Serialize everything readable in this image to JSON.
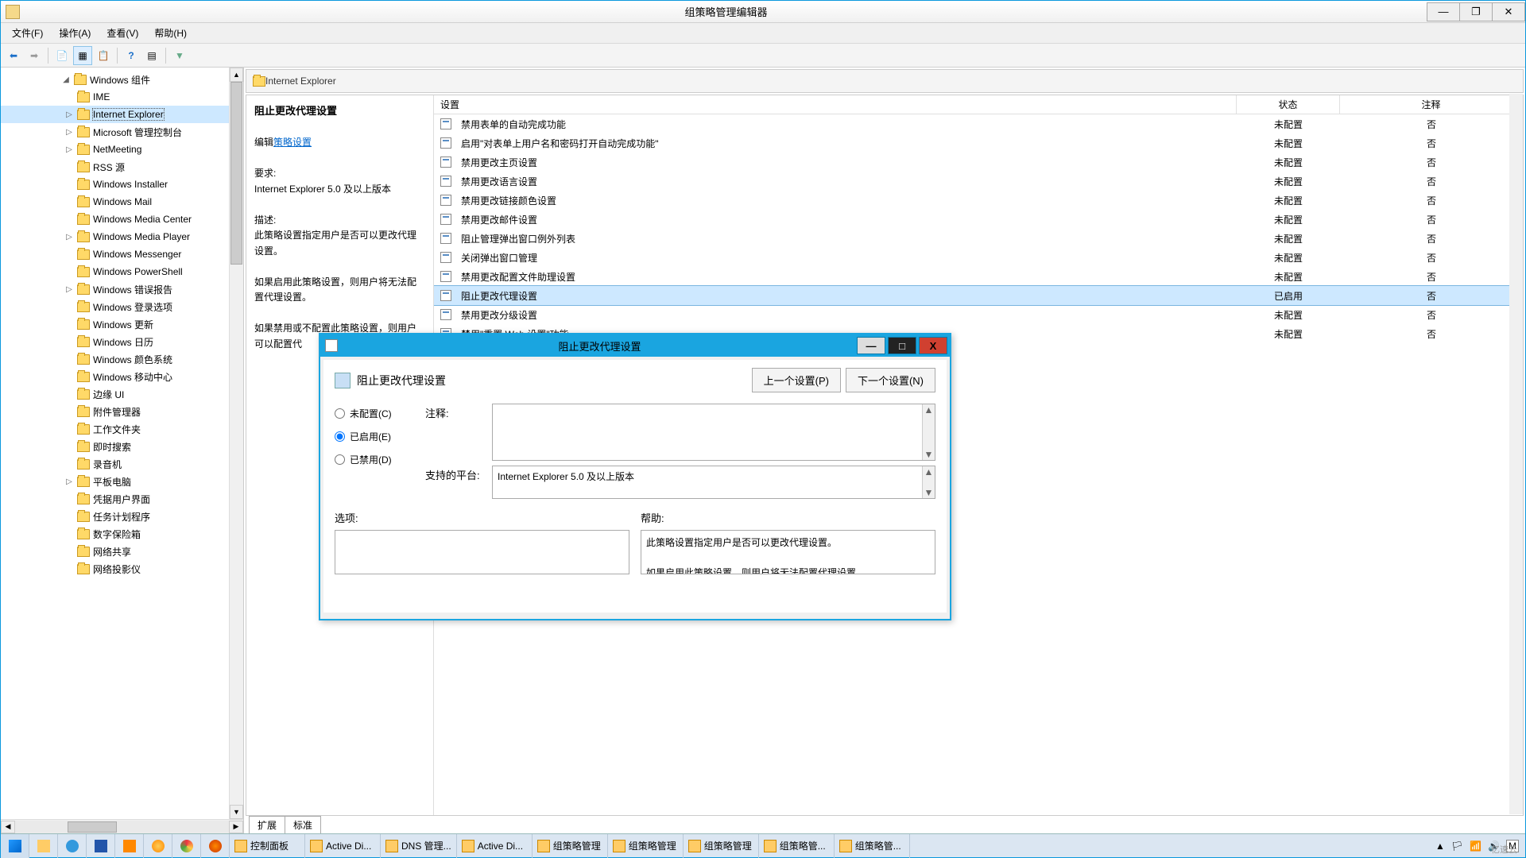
{
  "window": {
    "title": "组策略管理编辑器",
    "menu": {
      "file": "文件(F)",
      "action": "操作(A)",
      "view": "查看(V)",
      "help": "帮助(H)"
    }
  },
  "tree": {
    "root": "Windows 组件",
    "items": [
      {
        "label": "IME",
        "exp": ""
      },
      {
        "label": "Internet Explorer",
        "exp": "▷",
        "selected": true
      },
      {
        "label": "Microsoft 管理控制台",
        "exp": "▷"
      },
      {
        "label": "NetMeeting",
        "exp": "▷"
      },
      {
        "label": "RSS 源",
        "exp": ""
      },
      {
        "label": "Windows Installer",
        "exp": ""
      },
      {
        "label": "Windows Mail",
        "exp": ""
      },
      {
        "label": "Windows Media Center",
        "exp": ""
      },
      {
        "label": "Windows Media Player",
        "exp": "▷"
      },
      {
        "label": "Windows Messenger",
        "exp": ""
      },
      {
        "label": "Windows PowerShell",
        "exp": ""
      },
      {
        "label": "Windows 错误报告",
        "exp": "▷"
      },
      {
        "label": "Windows 登录选项",
        "exp": ""
      },
      {
        "label": "Windows 更新",
        "exp": ""
      },
      {
        "label": "Windows 日历",
        "exp": ""
      },
      {
        "label": "Windows 颜色系统",
        "exp": ""
      },
      {
        "label": "Windows 移动中心",
        "exp": ""
      },
      {
        "label": "边缘 UI",
        "exp": ""
      },
      {
        "label": "附件管理器",
        "exp": ""
      },
      {
        "label": "工作文件夹",
        "exp": ""
      },
      {
        "label": "即时搜索",
        "exp": ""
      },
      {
        "label": "录音机",
        "exp": ""
      },
      {
        "label": "平板电脑",
        "exp": "▷"
      },
      {
        "label": "凭据用户界面",
        "exp": ""
      },
      {
        "label": "任务计划程序",
        "exp": ""
      },
      {
        "label": "数字保险箱",
        "exp": ""
      },
      {
        "label": "网络共享",
        "exp": ""
      },
      {
        "label": "网络投影仪",
        "exp": ""
      }
    ]
  },
  "content": {
    "heading": "Internet Explorer",
    "setting_title": "阻止更改代理设置",
    "edit_prefix": "编辑",
    "edit_link": "策略设置",
    "req_label": "要求:",
    "req_text": "Internet Explorer 5.0 及以上版本",
    "desc_label": "描述:",
    "desc_text": "此策略设置指定用户是否可以更改代理设置。",
    "desc_p2": "如果启用此策略设置，则用户将无法配置代理设置。",
    "desc_p3": "如果禁用或不配置此策略设置，则用户可以配置代",
    "columns": {
      "setting": "设置",
      "state": "状态",
      "note": "注释"
    },
    "rows": [
      {
        "s": "禁用表单的自动完成功能",
        "st": "未配置",
        "n": "否"
      },
      {
        "s": "启用\"对表单上用户名和密码打开自动完成功能\"",
        "st": "未配置",
        "n": "否"
      },
      {
        "s": "禁用更改主页设置",
        "st": "未配置",
        "n": "否"
      },
      {
        "s": "禁用更改语言设置",
        "st": "未配置",
        "n": "否"
      },
      {
        "s": "禁用更改链接颜色设置",
        "st": "未配置",
        "n": "否"
      },
      {
        "s": "禁用更改邮件设置",
        "st": "未配置",
        "n": "否"
      },
      {
        "s": "阻止管理弹出窗口例外列表",
        "st": "未配置",
        "n": "否"
      },
      {
        "s": "关闭弹出窗口管理",
        "st": "未配置",
        "n": "否"
      },
      {
        "s": "禁用更改配置文件助理设置",
        "st": "未配置",
        "n": "否"
      },
      {
        "s": "阻止更改代理设置",
        "st": "已启用",
        "n": "否",
        "selected": true
      },
      {
        "s": "禁用更改分级设置",
        "st": "未配置",
        "n": "否"
      },
      {
        "s": "禁用\"重置 Web 设置\"功能",
        "st": "未配置",
        "n": "否"
      }
    ],
    "tabs": {
      "ext": "扩展",
      "std": "标准"
    }
  },
  "dialog": {
    "title": "阻止更改代理设置",
    "head": "阻止更改代理设置",
    "prev": "上一个设置(P)",
    "next": "下一个设置(N)",
    "opt_nc": "未配置(C)",
    "opt_en": "已启用(E)",
    "opt_dis": "已禁用(D)",
    "comment": "注释:",
    "platform": "支持的平台:",
    "platform_val": "Internet Explorer 5.0 及以上版本",
    "options": "选项:",
    "help": "帮助:",
    "help_p1": "此策略设置指定用户是否可以更改代理设置。",
    "help_p2": "如果启用此策略设置，则用户将无法配置代理设置。"
  },
  "taskbar": {
    "items": [
      {
        "label": "控制面板"
      },
      {
        "label": "Active Di..."
      },
      {
        "label": "DNS 管理..."
      },
      {
        "label": "Active Di..."
      },
      {
        "label": "组策略管理"
      },
      {
        "label": "组策略管理"
      },
      {
        "label": "组策略管理"
      },
      {
        "label": "组策略管..."
      },
      {
        "label": "组策略管..."
      }
    ],
    "watermark": "亿速云"
  }
}
